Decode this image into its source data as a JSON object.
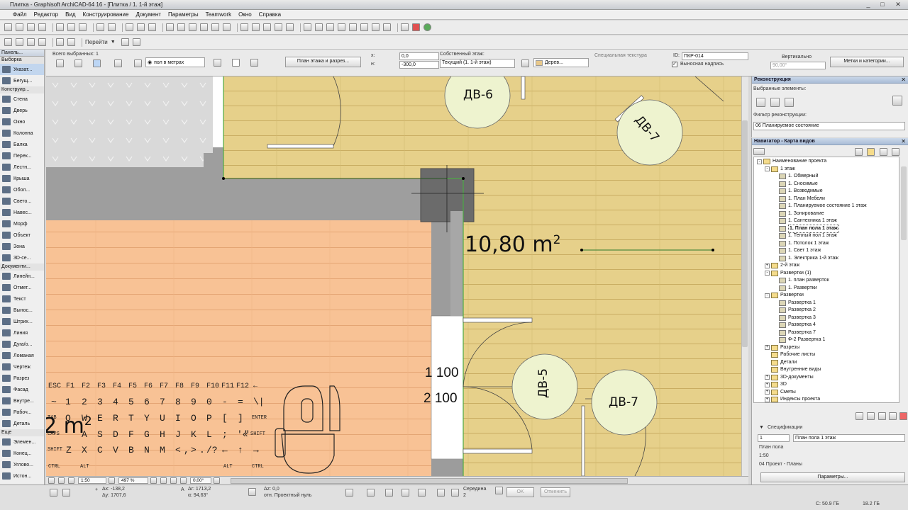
{
  "window": {
    "title": "Плитка - Graphisoft ArchiCAD-64 16 - [Плитка / 1. 1-й этаж]",
    "controls": [
      "_",
      "□",
      "✕"
    ]
  },
  "menu": [
    "Файл",
    "Редактор",
    "Вид",
    "Конструирование",
    "Документ",
    "Параметры",
    "Teamwork",
    "Окно",
    "Справка"
  ],
  "toolbar2": {
    "goto": "Перейти"
  },
  "toolbox": {
    "title": "Панель...",
    "selection": "Выборка",
    "pointer": "Указат...",
    "marquee": "Бегущ...",
    "groups": [
      {
        "name": "Конструир...",
        "items": [
          "Стена",
          "Дверь",
          "Окно",
          "Колонна",
          "Балка",
          "Перек...",
          "Лестн...",
          "Крыша",
          "Обол...",
          "Свето...",
          "Навес...",
          "Морф",
          "Объект",
          "Зона",
          "3D-се..."
        ]
      },
      {
        "name": "Документи...",
        "items": [
          "Линейн...",
          "Отмет...",
          "Текст",
          "Вынос...",
          "Штрих...",
          "Линия",
          "Дуга/о...",
          "Ломаная",
          "Чертеж",
          "Разрез",
          "Фасад",
          "Внутре...",
          "Рабоч...",
          "Деталь"
        ]
      },
      {
        "name": "Еще",
        "items": [
          "Элемен...",
          "Конец...",
          "Углово...",
          "Истон..."
        ]
      }
    ]
  },
  "infobox": {
    "selected": "Всего выбранных: 1",
    "floor_mode": "пол в метрах",
    "plan_button": "План этажа и разрез...",
    "dx": "0,0",
    "dy": "-300,0",
    "own_floor_label": "Собственный этаж:",
    "own_floor_value": "Текущий (1. 1-й этаж)",
    "material": "Дерев...",
    "special_texture": "Специальная текстура",
    "id_label": "ID:",
    "id_value": "ПКР-014",
    "callout": "Выносная надпись",
    "vertical": "Вертикально",
    "angle": "90,00°",
    "tags_button": "Метки и категории..."
  },
  "drawing": {
    "doors": [
      "ДВ-6",
      "ДВ-7",
      "ДВ-5",
      "ДВ-7"
    ],
    "area": "10,80 m",
    "area_sup": "2",
    "area_left": "2 m",
    "dim_1": "1",
    "dim_1_val": "100",
    "dim_2": "2",
    "dim_2_val": "100"
  },
  "keyboard": {
    "row1": [
      "ESC",
      "F1",
      "F2",
      "F3",
      "F4",
      "F5",
      "F6",
      "F7",
      "F8",
      "F9",
      "F10",
      "F11",
      "F12",
      "←"
    ],
    "row2": [
      "~",
      "1",
      "2",
      "3",
      "4",
      "5",
      "6",
      "7",
      "8",
      "9",
      "0",
      "-",
      "=",
      "\\|"
    ],
    "row3": [
      "TAB",
      "Q",
      "W",
      "E",
      "R",
      "T",
      "Y",
      "U",
      "I",
      "O",
      "P",
      "[",
      "]",
      "ENTER"
    ],
    "row4": [
      "CAPS",
      "A",
      "S",
      "D",
      "F",
      "G",
      "H",
      "J",
      "K",
      "L",
      ";",
      "'«",
      "\"",
      "SHIFT"
    ],
    "row5": [
      "SHIFT",
      "Z",
      "X",
      "C",
      "V",
      "B",
      "N",
      "M",
      "<",
      ",",
      ">",
      ".",
      "/?",
      "←",
      "↑",
      "→"
    ],
    "row6": [
      "CTRL",
      "ALT",
      "ALT",
      "CTRL"
    ]
  },
  "zoombar": {
    "scale": "1:50",
    "zoom": "497 %",
    "angle": "0,00°"
  },
  "status": {
    "dx": "Δx: -138,2",
    "dy": "Δy: 1707,6",
    "r": "Δr: 1713,2",
    "a": "α: 94,63°",
    "z": "Δz: 0,0",
    "ref": "отн. Проектный нуль",
    "snap": "Середина",
    "snap_n": "2",
    "ok": "OK",
    "cancel": "Отменить",
    "disk_c": "C: 50.9 ГБ",
    "ram": "18.2 ГБ"
  },
  "reconstruction": {
    "title": "Реконструкция",
    "selected_label": "Выбранные элементы:",
    "filter_label": "Фильтр реконструкции:",
    "filter_value": "06 Планируемое состояние"
  },
  "navigator": {
    "title": "Навигатор - Карта видов",
    "project": "Наименование проекта",
    "floor1": "1 этаж",
    "floor1_views": [
      "1. Обмерный",
      "1. Сносимые",
      "1. Возводимые",
      "1. План Мебели",
      "1. Планируемое состояние 1 этаж",
      "1. Зонирование",
      "1. Сантехника 1 этаж",
      "1. План пола 1 этаж",
      "1. Теплый пол 1 этаж",
      "1. Потолок 1 этаж",
      "1. Свет 1 этаж",
      "1. Электрика 1-й этаж"
    ],
    "floor2": "2-й этаж",
    "elev1": "Развертки (1)",
    "elev1_views": [
      "1. план разверток",
      "1. Развертки"
    ],
    "elev": "Развертки",
    "elev_views": [
      "Развертка 1",
      "Развертка 2",
      "Развертка 3",
      "Развертка 4",
      "Развертка 7",
      "Ф-2 Развертка 1"
    ],
    "rest": [
      "Разрезы",
      "Рабочие листы",
      "Детали",
      "Внутренние виды",
      "3D-документы",
      "3D",
      "Сметы",
      "Индексы проекта"
    ],
    "spec_title": "Спецификации",
    "spec_num": "1",
    "spec_name": "План пола 1 этаж",
    "spec_rows": [
      "План пола",
      "1:50",
      "04 Проект - Планы"
    ],
    "params_button": "Параметры..."
  }
}
